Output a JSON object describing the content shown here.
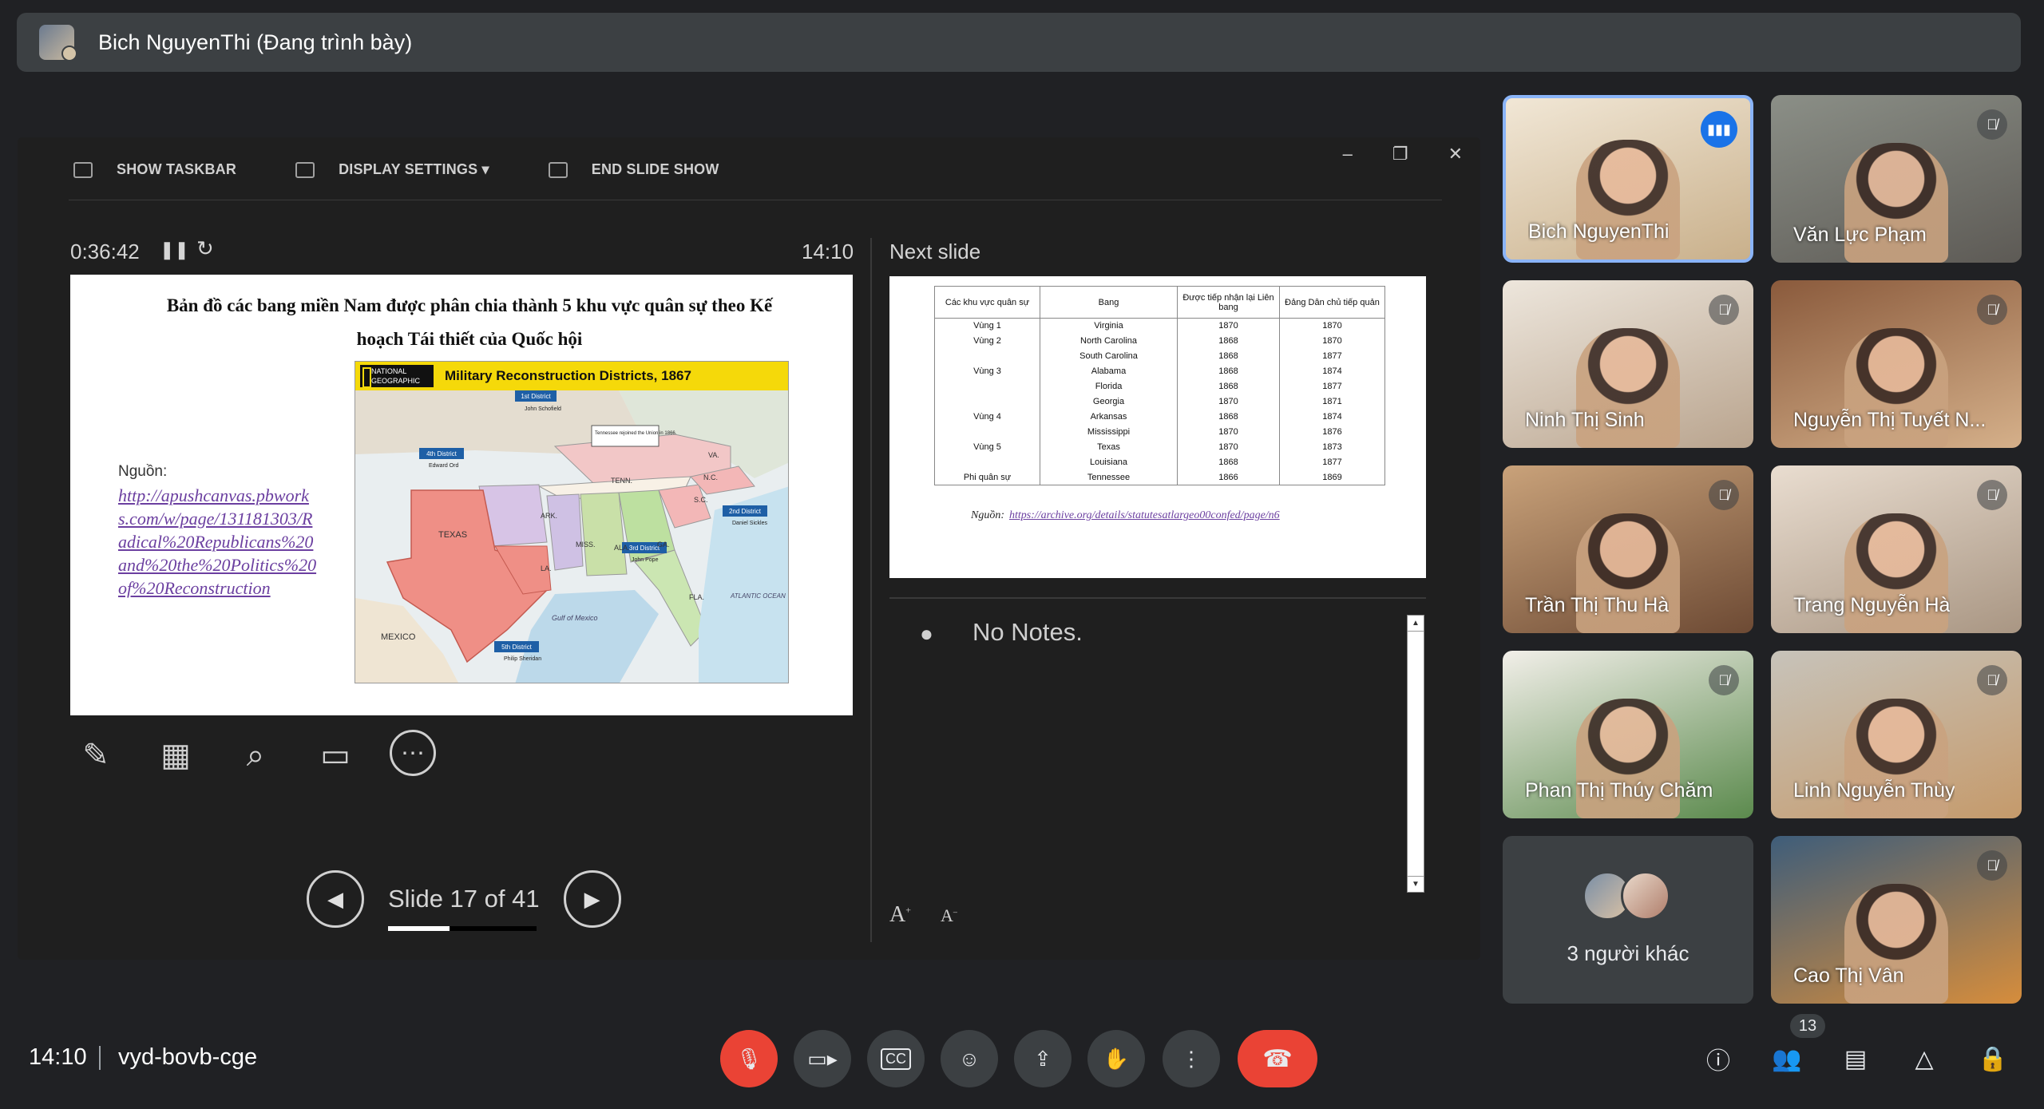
{
  "presenter": {
    "name": "Bich NguyenThi (Đang trình bày)"
  },
  "ppt": {
    "toolbar": {
      "show_taskbar": "SHOW TASKBAR",
      "display_settings": "DISPLAY SETTINGS ▾",
      "end_slide_show": "END SLIDE SHOW"
    },
    "window_controls": {
      "minimize": "–",
      "restore": "❐",
      "close": "✕"
    },
    "timer": "0:36:42",
    "clock": "14:10",
    "current_slide": {
      "title": "Bản đồ các bang miền Nam được phân chia thành 5 khu vực quân sự theo Kế hoạch Tái thiết của Quốc hội",
      "source_label": "Nguồn:",
      "source_link": "http://apushcanvas.pbworks.com/w/page/131181303/Radical%20Republicans%20and%20the%20Politics%20of%20Reconstruction",
      "map_brand": "NATIONAL GEOGRAPHIC",
      "map_title": "Military Reconstruction Districts, 1867",
      "map_labels": {
        "d1": "1st District",
        "d1_cmd": "John Schofield",
        "d2": "2nd District",
        "d2_cmd": "Daniel Sickles",
        "d3": "3rd District",
        "d3_cmd": "John Pope",
        "d4": "4th District",
        "d4_cmd": "Edward Ord",
        "d5": "5th District",
        "d5_cmd": "Philip Sheridan",
        "tn_note": "Tennessee rejoined the Union in 1866.",
        "texas": "TEXAS",
        "mexico": "MEXICO",
        "gulf": "Gulf of Mexico",
        "atlantic": "ATLANTIC OCEAN",
        "tenn": "TENN.",
        "ark": "ARK.",
        "la": "LA.",
        "miss": "MISS.",
        "ala": "ALA.",
        "ga": "GA.",
        "fla": "FLA.",
        "sc": "S.C.",
        "nc": "N.C.",
        "va": "VA."
      }
    },
    "slide_counter": "Slide 17 of 41",
    "slide_progress": 0.415,
    "next_label": "Next slide",
    "next_slide": {
      "headers": [
        "Các khu vực quân sự",
        "Bang",
        "Được tiếp nhận lại Liên bang",
        "Đảng Dân chủ tiếp quản"
      ],
      "rows": [
        [
          "Vùng 1",
          "Virginia",
          "1870",
          "1870"
        ],
        [
          "Vùng 2",
          "North Carolina",
          "1868",
          "1870"
        ],
        [
          "",
          "South Carolina",
          "1868",
          "1877"
        ],
        [
          "Vùng 3",
          "Alabama",
          "1868",
          "1874"
        ],
        [
          "",
          "Florida",
          "1868",
          "1877"
        ],
        [
          "",
          "Georgia",
          "1870",
          "1871"
        ],
        [
          "Vùng 4",
          "Arkansas",
          "1868",
          "1874"
        ],
        [
          "",
          "Mississippi",
          "1870",
          "1876"
        ],
        [
          "Vùng 5",
          "Texas",
          "1870",
          "1873"
        ],
        [
          "",
          "Louisiana",
          "1868",
          "1877"
        ],
        [
          "Phi quân sự",
          "Tennessee",
          "1866",
          "1869"
        ]
      ],
      "source_label": "Nguồn:",
      "source_link": "https://archive.org/details/statutesatlargeo00confed/page/n6"
    },
    "notes": "No Notes."
  },
  "participants": [
    {
      "name": "Bich NguyenThi",
      "speaking": true
    },
    {
      "name": "Văn Lực Phạm",
      "muted": true
    },
    {
      "name": "Ninh Thị Sinh",
      "muted": true
    },
    {
      "name": "Nguyễn Thị Tuyết N...",
      "muted": true
    },
    {
      "name": "Trần Thị Thu Hà",
      "muted": true
    },
    {
      "name": "Trang Nguyễn Hà",
      "muted": true
    },
    {
      "name": "Phan Thị Thúy Chăm",
      "muted": true
    },
    {
      "name": "Linh Nguyễn Thùy",
      "muted": true
    },
    {
      "name": "3 người khác"
    },
    {
      "name": "Cao Thị Vân",
      "muted": true
    }
  ],
  "meeting": {
    "time": "14:10",
    "code": "vyd-bovb-cge",
    "people_count": "13"
  }
}
